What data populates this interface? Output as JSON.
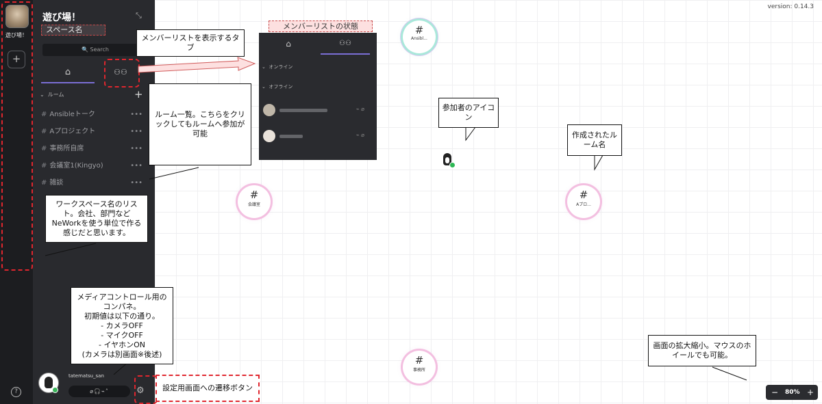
{
  "rail": {
    "workspace_label": "遊び場！",
    "add_label": "+",
    "help_label": "?"
  },
  "sidebar": {
    "title": "遊び場！",
    "space_name": "スペース名",
    "search_label": "🔍 Search",
    "rooms_header": "ルーム",
    "add_room": "+",
    "rooms": [
      {
        "name": "Ansibleトーク"
      },
      {
        "name": "Aプロジェクト"
      },
      {
        "name": "事務所自席"
      },
      {
        "name": "会議室1(Kingyo)"
      },
      {
        "name": "雑談"
      }
    ],
    "more_label": "•••",
    "user_name": "tatematsu_san"
  },
  "canvas": {
    "version": "version: 0.14.3",
    "zoom": {
      "minus": "−",
      "value": "80%",
      "plus": "+"
    },
    "room_nodes": [
      {
        "name": "Ansibl..."
      },
      {
        "name": "会議室"
      },
      {
        "name": "Aプロ..."
      },
      {
        "name": "事務所"
      }
    ]
  },
  "member_panel": {
    "caption": "メンバーリストの状態",
    "online_label": "オンライン",
    "offline_label": "オフライン"
  },
  "annotations": {
    "member_tab": "メンバーリストを表示するタブ",
    "room_list": "ルーム一覧。こちらをクリックしてもルームへ参加が可能",
    "workspace_list": "ワークスペース名のリスト。会社、部門などNeWorkを使う単位で作る感じだと思います。",
    "media_control": "メディアコントロール用のコンパネ。\n初期値は以下の通り。\n- カメラOFF\n- マイクOFF\n- イヤホンON\n(カメラは別画面※後述)",
    "settings": "設定用画面への遷移ボタン",
    "participant_icon": "参加者のアイコン",
    "room_name": "作成されたルーム名",
    "zoom_help": "画面の拡大縮小。マウスのホイールでも可能。"
  }
}
